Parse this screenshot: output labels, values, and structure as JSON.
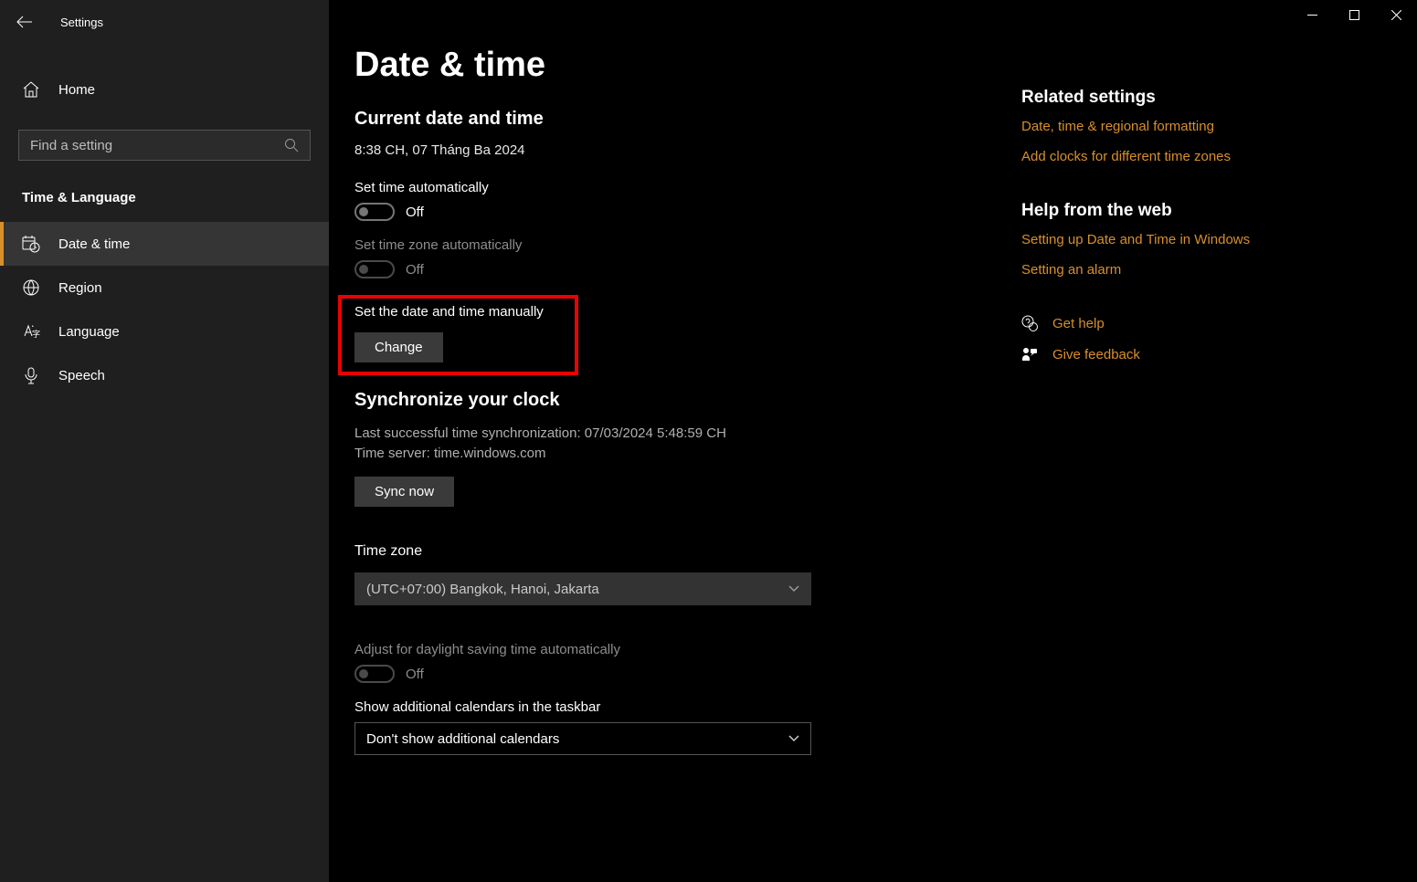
{
  "window": {
    "title": "Settings"
  },
  "sidebar": {
    "home_label": "Home",
    "search_placeholder": "Find a setting",
    "category": "Time & Language",
    "items": [
      {
        "label": "Date & time"
      },
      {
        "label": "Region"
      },
      {
        "label": "Language"
      },
      {
        "label": "Speech"
      }
    ]
  },
  "main": {
    "heading": "Date & time",
    "current_heading": "Current date and time",
    "current_value": "8:38 CH, 07 Tháng Ba 2024",
    "set_time_auto_label": "Set time automatically",
    "set_time_auto_state": "Off",
    "set_tz_auto_label": "Set time zone automatically",
    "set_tz_auto_state": "Off",
    "set_manual_label": "Set the date and time manually",
    "change_button": "Change",
    "sync_heading": "Synchronize your clock",
    "sync_last": "Last successful time synchronization: 07/03/2024 5:48:59 CH",
    "sync_server": "Time server: time.windows.com",
    "sync_button": "Sync now",
    "tz_heading": "Time zone",
    "tz_value": "(UTC+07:00) Bangkok, Hanoi, Jakarta",
    "dst_label": "Adjust for daylight saving time automatically",
    "dst_state": "Off",
    "additional_cal_label": "Show additional calendars in the taskbar",
    "additional_cal_value": "Don't show additional calendars"
  },
  "side": {
    "related_heading": "Related settings",
    "related_links": [
      "Date, time & regional formatting",
      "Add clocks for different time zones"
    ],
    "help_heading": "Help from the web",
    "help_links": [
      "Setting up Date and Time in Windows",
      "Setting an alarm"
    ],
    "get_help": "Get help",
    "give_feedback": "Give feedback"
  }
}
